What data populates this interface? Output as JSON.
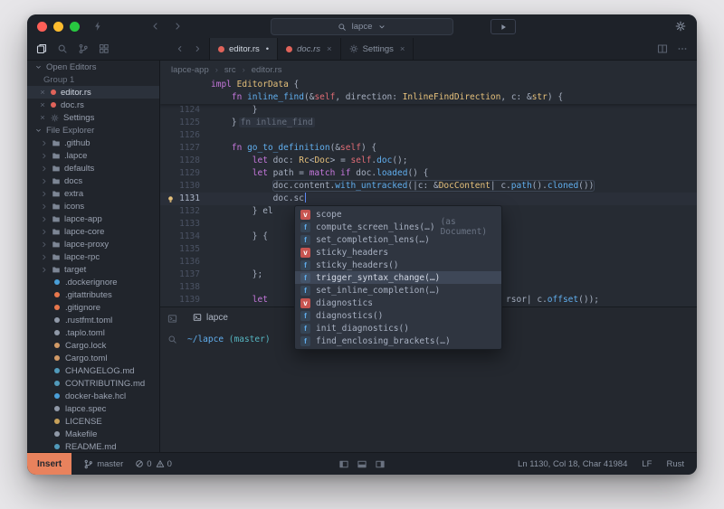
{
  "window": {
    "traffic_lights": {
      "close": "#ff5f57",
      "minimize": "#febc2e",
      "zoom": "#28c840"
    }
  },
  "titlebar": {
    "search_value": "lapce"
  },
  "activity_bar": {
    "icons": [
      {
        "name": "files-icon",
        "active": true
      },
      {
        "name": "search-icon",
        "active": false
      },
      {
        "name": "source-control-icon",
        "active": false
      },
      {
        "name": "extensions-icon",
        "active": false
      }
    ]
  },
  "sidebar": {
    "open_editors": {
      "label": "Open Editors",
      "group_label": "Group 1",
      "items": [
        {
          "label": "editor.rs",
          "icon": "rust-file-icon",
          "color": "#e0635a",
          "active": true
        },
        {
          "label": "doc.rs",
          "icon": "rust-file-icon",
          "color": "#e0635a",
          "active": false
        },
        {
          "label": "Settings",
          "icon": "gear-icon",
          "active": false
        }
      ]
    },
    "file_explorer": {
      "label": "File Explorer",
      "folders": [
        ".github",
        ".lapce",
        "defaults",
        "docs",
        "extra",
        "icons",
        "lapce-app",
        "lapce-core",
        "lapce-proxy",
        "lapce-rpc",
        "target"
      ],
      "files": [
        {
          "name": ".dockerignore",
          "color": "#4a9fd8"
        },
        {
          "name": ".gitattributes",
          "color": "#e8774c"
        },
        {
          "name": ".gitignore",
          "color": "#e8774c"
        },
        {
          "name": ".rustfmt.toml",
          "color": "#9099a8"
        },
        {
          "name": ".taplo.toml",
          "color": "#9099a8"
        },
        {
          "name": "Cargo.lock",
          "color": "#d19a66"
        },
        {
          "name": "Cargo.toml",
          "color": "#d19a66"
        },
        {
          "name": "CHANGELOG.md",
          "color": "#519aba"
        },
        {
          "name": "CONTRIBUTING.md",
          "color": "#519aba"
        },
        {
          "name": "docker-bake.hcl",
          "color": "#4a9fd8"
        },
        {
          "name": "lapce.spec",
          "color": "#9099a8"
        },
        {
          "name": "LICENSE",
          "color": "#c7a15a"
        },
        {
          "name": "Makefile",
          "color": "#9099a8"
        },
        {
          "name": "README.md",
          "color": "#519aba"
        }
      ]
    }
  },
  "editor": {
    "tabs": [
      {
        "label": "editor.rs",
        "icon": "rust-file-icon",
        "icon_color": "#e0635a",
        "active": true,
        "indicator": "•",
        "italic": false
      },
      {
        "label": "doc.rs",
        "icon": "rust-file-icon",
        "icon_color": "#e0635a",
        "active": false,
        "indicator": "×",
        "italic": true
      },
      {
        "label": "Settings",
        "icon": "gear-icon",
        "icon_color": "",
        "active": false,
        "indicator": "×",
        "italic": false
      }
    ],
    "breadcrumb": [
      "lapce-app",
      "src",
      "editor.rs"
    ],
    "sticky_lines": [
      {
        "tokens": [
          [
            "k",
            "impl"
          ],
          [
            "p",
            " "
          ],
          [
            "t",
            "EditorData"
          ],
          [
            "p",
            " {"
          ]
        ]
      },
      {
        "tokens": [
          [
            "p",
            "    "
          ],
          [
            "k",
            "fn"
          ],
          [
            "p",
            " "
          ],
          [
            "f",
            "inline_find"
          ],
          [
            "p",
            "(&"
          ],
          [
            "s",
            "self"
          ],
          [
            "p",
            ", direction: "
          ],
          [
            "t",
            "InlineFindDirection"
          ],
          [
            "p",
            ", c: &"
          ],
          [
            "t",
            "str"
          ],
          [
            "p",
            ") {"
          ]
        ]
      }
    ],
    "lines": [
      {
        "num": "1124",
        "tokens": [
          [
            "p",
            "        }"
          ]
        ]
      },
      {
        "num": "1125",
        "tokens": [
          [
            "p",
            "    }"
          ],
          [
            "gh",
            "fn inline_find"
          ]
        ]
      },
      {
        "num": "1126",
        "tokens": []
      },
      {
        "num": "1127",
        "tokens": [
          [
            "p",
            "    "
          ],
          [
            "k",
            "fn"
          ],
          [
            "p",
            " "
          ],
          [
            "f",
            "go_to_definition"
          ],
          [
            "p",
            "(&"
          ],
          [
            "s",
            "self"
          ],
          [
            "p",
            ") {"
          ]
        ]
      },
      {
        "num": "1128",
        "tokens": [
          [
            "p",
            "        "
          ],
          [
            "k",
            "let"
          ],
          [
            "p",
            " doc: "
          ],
          [
            "t",
            "Rc"
          ],
          [
            "p",
            "<"
          ],
          [
            "t",
            "Doc"
          ],
          [
            "p",
            "> = "
          ],
          [
            "s",
            "self"
          ],
          [
            "p",
            "."
          ],
          [
            "f",
            "doc"
          ],
          [
            "p",
            "();"
          ]
        ]
      },
      {
        "num": "1129",
        "tokens": [
          [
            "p",
            "        "
          ],
          [
            "k",
            "let"
          ],
          [
            "p",
            " path = "
          ],
          [
            "k",
            "match"
          ],
          [
            "p",
            " "
          ],
          [
            "k",
            "if"
          ],
          [
            "p",
            " doc."
          ],
          [
            "f",
            "loaded"
          ],
          [
            "p",
            "() {"
          ]
        ]
      },
      {
        "num": "1130",
        "boxed": true,
        "tokens": [
          [
            "p",
            "            "
          ],
          [
            "p",
            "doc.content."
          ],
          [
            "f",
            "with_untracked"
          ],
          [
            "p",
            "(|c: &"
          ],
          [
            "t",
            "DocContent"
          ],
          [
            "p",
            "| c."
          ],
          [
            "f",
            "path"
          ],
          [
            "p",
            "()."
          ],
          [
            "f",
            "cloned"
          ],
          [
            "p",
            "())"
          ]
        ]
      },
      {
        "num": "1131",
        "active": true,
        "cursor": true,
        "lightbulb": true,
        "tokens": [
          [
            "p",
            "            doc.sc"
          ]
        ]
      },
      {
        "num": "1132",
        "tokens": [
          [
            "p",
            "        } el"
          ]
        ]
      },
      {
        "num": "1133",
        "tokens": []
      },
      {
        "num": "1134",
        "tokens": [
          [
            "p",
            "        } {"
          ]
        ]
      },
      {
        "num": "1135",
        "tokens": []
      },
      {
        "num": "1136",
        "tokens": []
      },
      {
        "num": "1137",
        "tokens": [
          [
            "p",
            "        };"
          ]
        ]
      },
      {
        "num": "1138",
        "tokens": []
      },
      {
        "num": "1139",
        "tokens": [
          [
            "p",
            "        "
          ],
          [
            "k",
            "let"
          ],
          [
            "p",
            "                                              rsor| c."
          ],
          [
            "f",
            "offset"
          ],
          [
            "p",
            "());"
          ]
        ]
      }
    ]
  },
  "completion": {
    "kind_colors": {
      "v": "#c75450",
      "f": "#61afef"
    },
    "items": [
      {
        "kind": "v",
        "label": "scope",
        "detail": "",
        "selected": false
      },
      {
        "kind": "f",
        "label": "compute_screen_lines(…)",
        "detail": "(as Document)",
        "selected": false
      },
      {
        "kind": "f",
        "label": "set_completion_lens(…)",
        "detail": "",
        "selected": false
      },
      {
        "kind": "v",
        "label": "sticky_headers",
        "detail": "",
        "selected": false
      },
      {
        "kind": "f",
        "label": "sticky_headers()",
        "detail": "",
        "selected": false
      },
      {
        "kind": "f",
        "label": "trigger_syntax_change(…)",
        "detail": "",
        "selected": true
      },
      {
        "kind": "f",
        "label": "set_inline_completion(…)",
        "detail": "",
        "selected": false
      },
      {
        "kind": "v",
        "label": "diagnostics",
        "detail": "",
        "selected": false
      },
      {
        "kind": "f",
        "label": "diagnostics()",
        "detail": "",
        "selected": false
      },
      {
        "kind": "f",
        "label": "init_diagnostics()",
        "detail": "",
        "selected": false
      },
      {
        "kind": "f",
        "label": "find_enclosing_brackets(…)",
        "detail": "",
        "selected": false
      }
    ]
  },
  "panel": {
    "tab_label": "lapce",
    "prompt_path": "~/lapce",
    "prompt_branch": "(master)"
  },
  "status": {
    "mode": "Insert",
    "mode_color": "#e8825d",
    "branch": "master",
    "errors": "0",
    "warnings": "0",
    "cursor_position": "Ln 1130, Col 18, Char 41984",
    "line_ending": "LF",
    "language": "Rust"
  }
}
